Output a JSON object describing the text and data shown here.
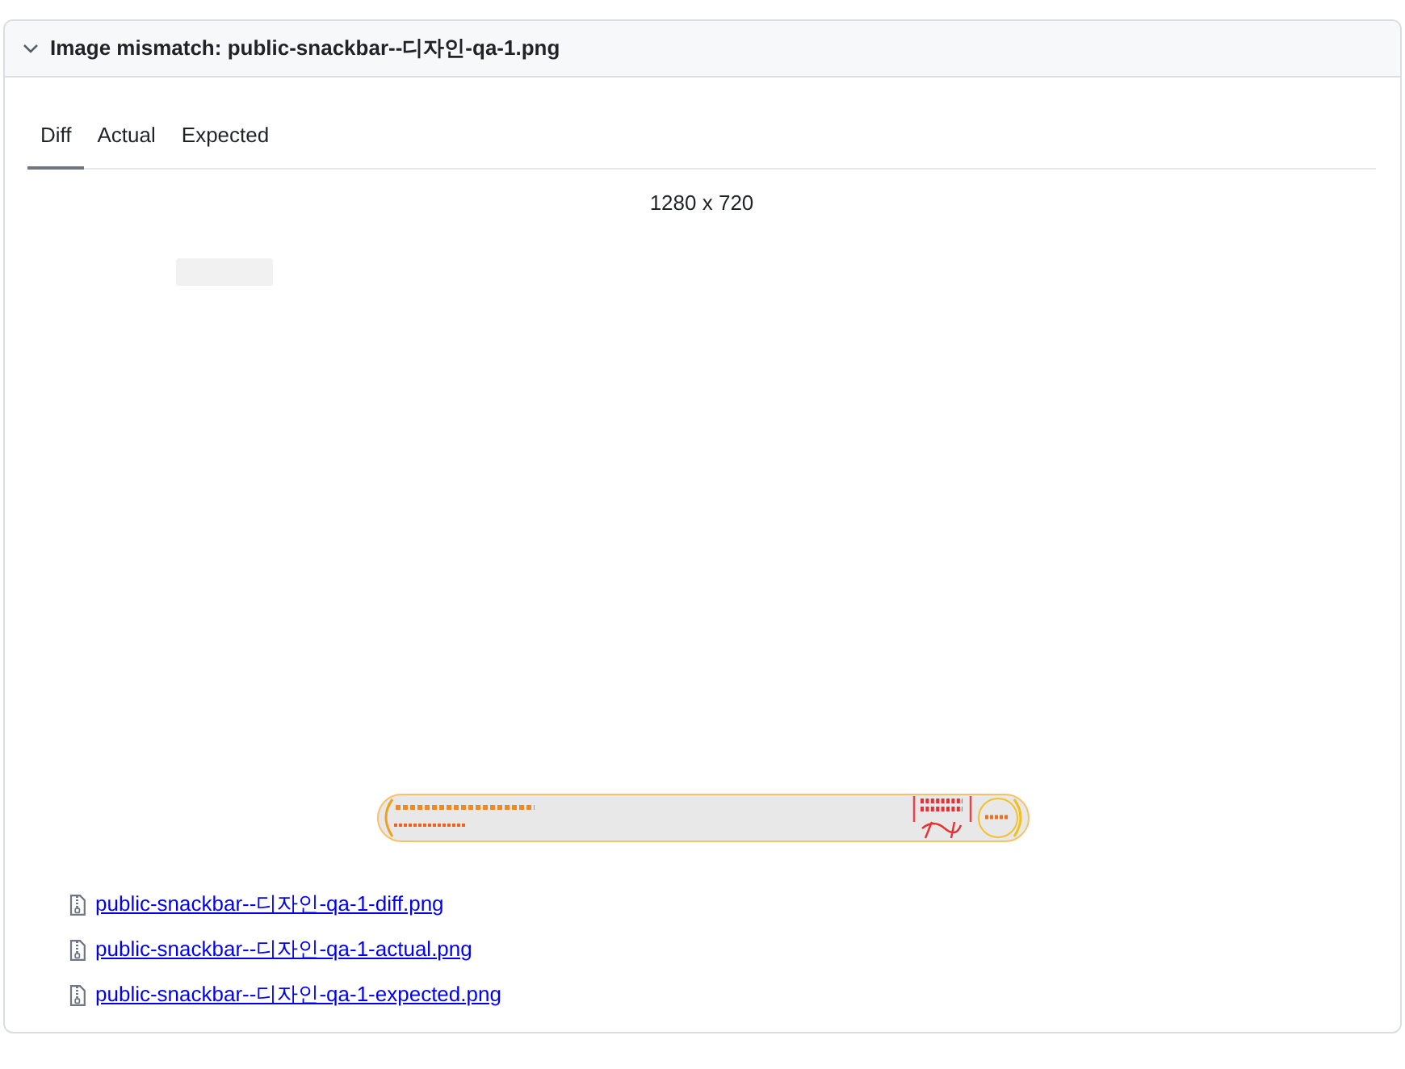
{
  "panel": {
    "expanded": true,
    "title": "Image mismatch: public-snackbar--디자인-qa-1.png"
  },
  "tabs": [
    {
      "label": "Diff",
      "selected": true
    },
    {
      "label": "Actual",
      "selected": false
    },
    {
      "label": "Expected",
      "selected": false
    }
  ],
  "image": {
    "dimensions": "1280 x 720"
  },
  "attachments": [
    {
      "name": "public-snackbar--디자인-qa-1-diff.png"
    },
    {
      "name": "public-snackbar--디자인-qa-1-actual.png"
    },
    {
      "name": "public-snackbar--디자인-qa-1-expected.png"
    }
  ]
}
